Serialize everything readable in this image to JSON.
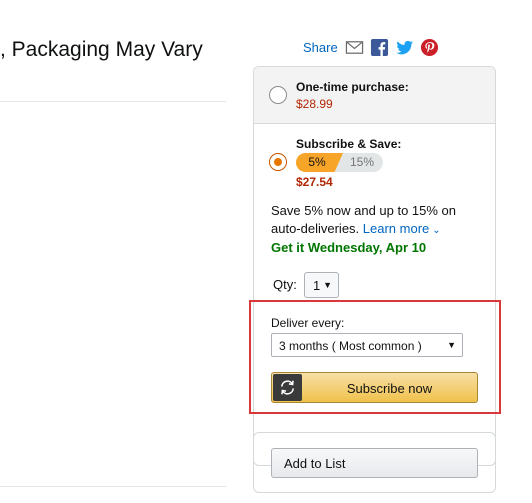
{
  "product": {
    "title_fragment": ", Packaging May Vary"
  },
  "share": {
    "label": "Share",
    "icons": [
      "email-icon",
      "facebook-icon",
      "twitter-icon",
      "pinterest-icon"
    ],
    "colors": {
      "facebook": "#3b5998",
      "twitter": "#1da1f2",
      "pinterest": "#cb2027"
    }
  },
  "purchase_options": {
    "one_time": {
      "label": "One-time purchase:",
      "price": "$28.99",
      "selected": false
    },
    "subscribe": {
      "label": "Subscribe & Save:",
      "discount_current": "5%",
      "discount_max": "15%",
      "price": "$27.54",
      "selected": true,
      "save_text": "Save 5% now and up to 15% on auto-deliveries.",
      "learn_more": "Learn more",
      "delivery": "Get it Wednesday, Apr 10"
    }
  },
  "qty": {
    "label": "Qty:",
    "value": "1"
  },
  "delivery_frequency": {
    "label": "Deliver every:",
    "value": "3 months ( Most common )"
  },
  "buttons": {
    "subscribe_now": "Subscribe now",
    "add_to_list": "Add to List"
  },
  "colors": {
    "price": "#b12704",
    "delivery": "#007600",
    "link": "#0066c0",
    "discount_pill": "#f7a528",
    "highlight": "#d9383a",
    "button_gold": "#f0c14b"
  }
}
